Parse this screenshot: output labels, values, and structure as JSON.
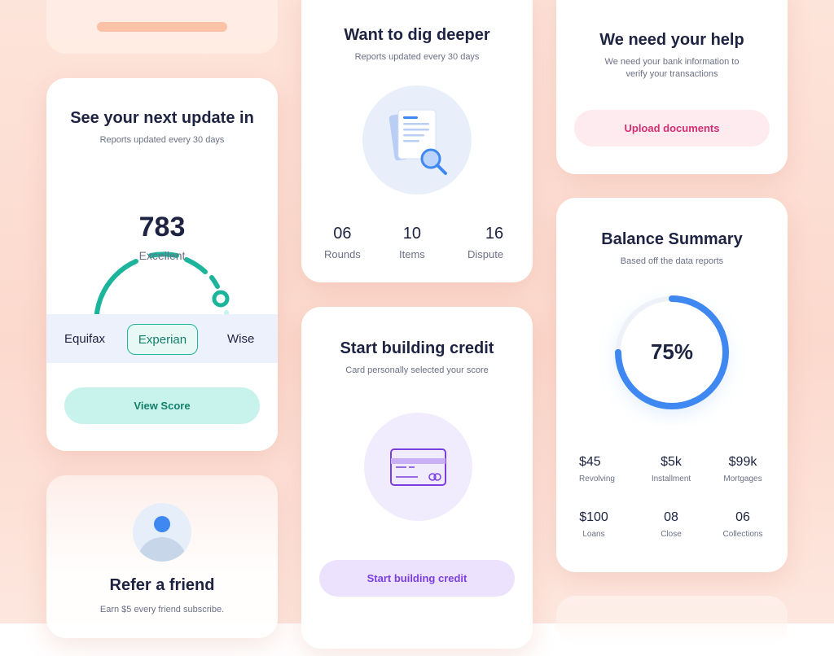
{
  "score_card": {
    "title": "See your next update in",
    "subtitle": "Reports updated every 30 days",
    "score": "783",
    "rating": "Excellent",
    "bureaus": [
      "Equifax",
      "Experian",
      "Wise"
    ],
    "selected_bureau": "Experian",
    "button_label": "View Score"
  },
  "referral_card": {
    "title": "Refer a friend",
    "subtitle": "Earn $5 every friend subscribe."
  },
  "dig_card": {
    "title": "Want to dig deeper",
    "subtitle": "Reports updated every 30 days",
    "stats": [
      {
        "value": "06",
        "label": "Rounds"
      },
      {
        "value": "10",
        "label": "Items"
      },
      {
        "value": "16",
        "label": "Dispute"
      }
    ]
  },
  "credit_card": {
    "title": "Start building credit",
    "subtitle": "Card personally selected your score",
    "button_label": "Start building credit"
  },
  "help_card": {
    "title": "We need your help",
    "subtitle": "We need your bank information to verify your transactions",
    "button_label": "Upload documents"
  },
  "balance_card": {
    "title": "Balance Summary",
    "subtitle": "Based off the data reports",
    "percent_label": "75%",
    "percent_value": 0.75,
    "items": [
      {
        "value": "$45",
        "label": "Revolving"
      },
      {
        "value": "$5k",
        "label": "Installment"
      },
      {
        "value": "$99k",
        "label": "Mortgages"
      },
      {
        "value": "$100",
        "label": "Loans"
      },
      {
        "value": "08",
        "label": "Close"
      },
      {
        "value": "06",
        "label": "Collections"
      }
    ]
  },
  "colors": {
    "teal": "#1cb49a",
    "teal_light": "#c8f3ec",
    "blue": "#3f88f2",
    "purple": "#7b3fe0",
    "pink": "#d42f72",
    "salmon": "#fcc2a8"
  }
}
